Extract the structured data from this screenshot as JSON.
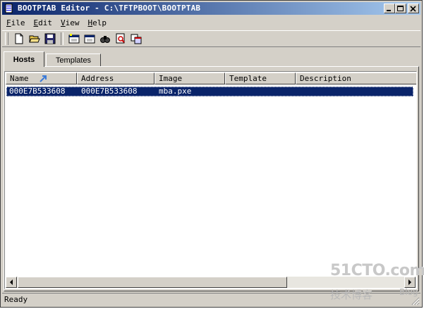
{
  "window": {
    "title": "BOOTPTAB Editor - C:\\TFTPBOOT\\BOOTPTAB",
    "buttons": [
      "minimize-icon",
      "maximize-icon",
      "close-icon"
    ]
  },
  "menu": {
    "items": [
      {
        "accel": "F",
        "rest": "ile"
      },
      {
        "accel": "E",
        "rest": "dit"
      },
      {
        "accel": "V",
        "rest": "iew"
      },
      {
        "accel": "H",
        "rest": "elp"
      }
    ]
  },
  "toolbar": {
    "icons": [
      "new-document-icon",
      "open-folder-icon",
      "save-icon",
      "add-host-icon",
      "edit-host-icon",
      "find-icon",
      "print-preview-icon",
      "properties-icon"
    ]
  },
  "tabs": [
    {
      "label": "Hosts",
      "active": true
    },
    {
      "label": "Templates",
      "active": false
    }
  ],
  "list": {
    "columns": [
      "Name",
      "Address",
      "Image",
      "Template",
      "Description"
    ],
    "rows": [
      {
        "name": "000E7B533608",
        "address": "000E7B533608",
        "image": "mba.pxe",
        "template": "",
        "description": "",
        "selected": true
      }
    ]
  },
  "status": {
    "text": "Ready"
  },
  "watermark": {
    "logo": "51CTO.com",
    "tagline": "技术博客",
    "blog": "Blog"
  },
  "colors": {
    "title_bar_start": "#0a246a",
    "title_bar_end": "#a6caf0",
    "selection": "#0a246a",
    "face": "#d4d0c8"
  }
}
